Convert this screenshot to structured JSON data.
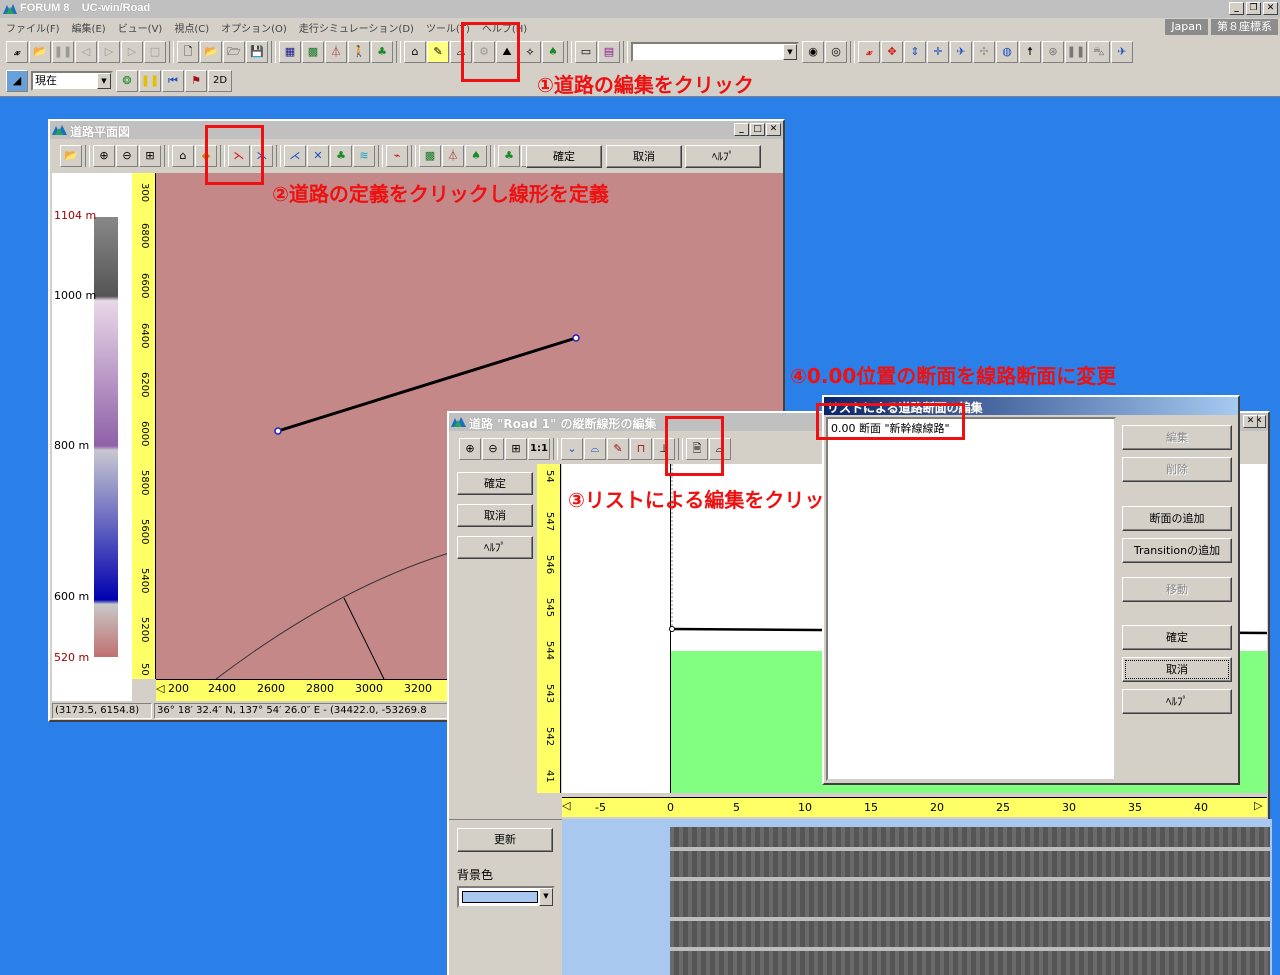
{
  "app": {
    "title": "FORUM 8    UC-win/Road",
    "locale_badge": "Japan",
    "coord_badge": "第８座標系"
  },
  "menu": [
    "ファイル(F)",
    "編集(E)",
    "ビュー(V)",
    "視点(C)",
    "オプション(O)",
    "走行シミュレーション(D)",
    "ツール(T)",
    "ヘルプ(H)"
  ],
  "toolbar2": {
    "time_select": "現在",
    "mode_2d": "2D"
  },
  "annotations": {
    "step1": "①道路の編集をクリック",
    "step2": "②道路の定義をクリックし線形を定義",
    "step3": "③リストによる編集をクリック",
    "step4": "④0.00位置の断面を線路断面に変更"
  },
  "plan_window": {
    "title": "道路平面図",
    "ok": "確定",
    "cancel": "取消",
    "help": "ﾍﾙﾌﾟ",
    "legend": [
      "1104 m",
      "1000 m",
      "800 m",
      "600 m",
      "520 m"
    ],
    "v_ticks": [
      "300",
      "6800",
      "6600",
      "6400",
      "6200",
      "6000",
      "5800",
      "5600",
      "5400",
      "5200",
      "50"
    ],
    "h_ticks": [
      "200",
      "2400",
      "2600",
      "2800",
      "3000",
      "3200"
    ],
    "status_xy": "(3173.5, 6154.8)",
    "status_geo": "36°  18′ 32.4″ N, 137°  54′ 26.0″ E  -  (34422.0, -53269.8"
  },
  "profile_window": {
    "title": "道路 \"Road 1\" の縦断線形の編集",
    "zoom_11": "1:1",
    "ok": "確定",
    "cancel": "取消",
    "help": "ﾍﾙﾌﾟ",
    "update": "更新",
    "bg_color_label": "背景色",
    "v_ticks": [
      "54",
      "547",
      "546",
      "545",
      "544",
      "543",
      "542",
      "41"
    ],
    "h_ticks": [
      "-5",
      "0",
      "5",
      "10",
      "15",
      "20",
      "25",
      "30",
      "35",
      "40"
    ]
  },
  "list_window": {
    "title": "リストによる道路断面の編集",
    "item": "0.00 断面 \"新幹線線路\"",
    "buttons": {
      "edit": "編集",
      "delete": "削除",
      "add_section": "断面の追加",
      "add_transition": "Transitionの追加",
      "move": "移動",
      "ok": "確定",
      "cancel": "取消",
      "help": "ﾍﾙﾌﾟ"
    }
  },
  "colors": {
    "desktop": "#2b7fe8",
    "annotation": "#ee1111",
    "terrain": "#c48888",
    "ground": "#80ff80",
    "ruler": "#ffff66"
  }
}
